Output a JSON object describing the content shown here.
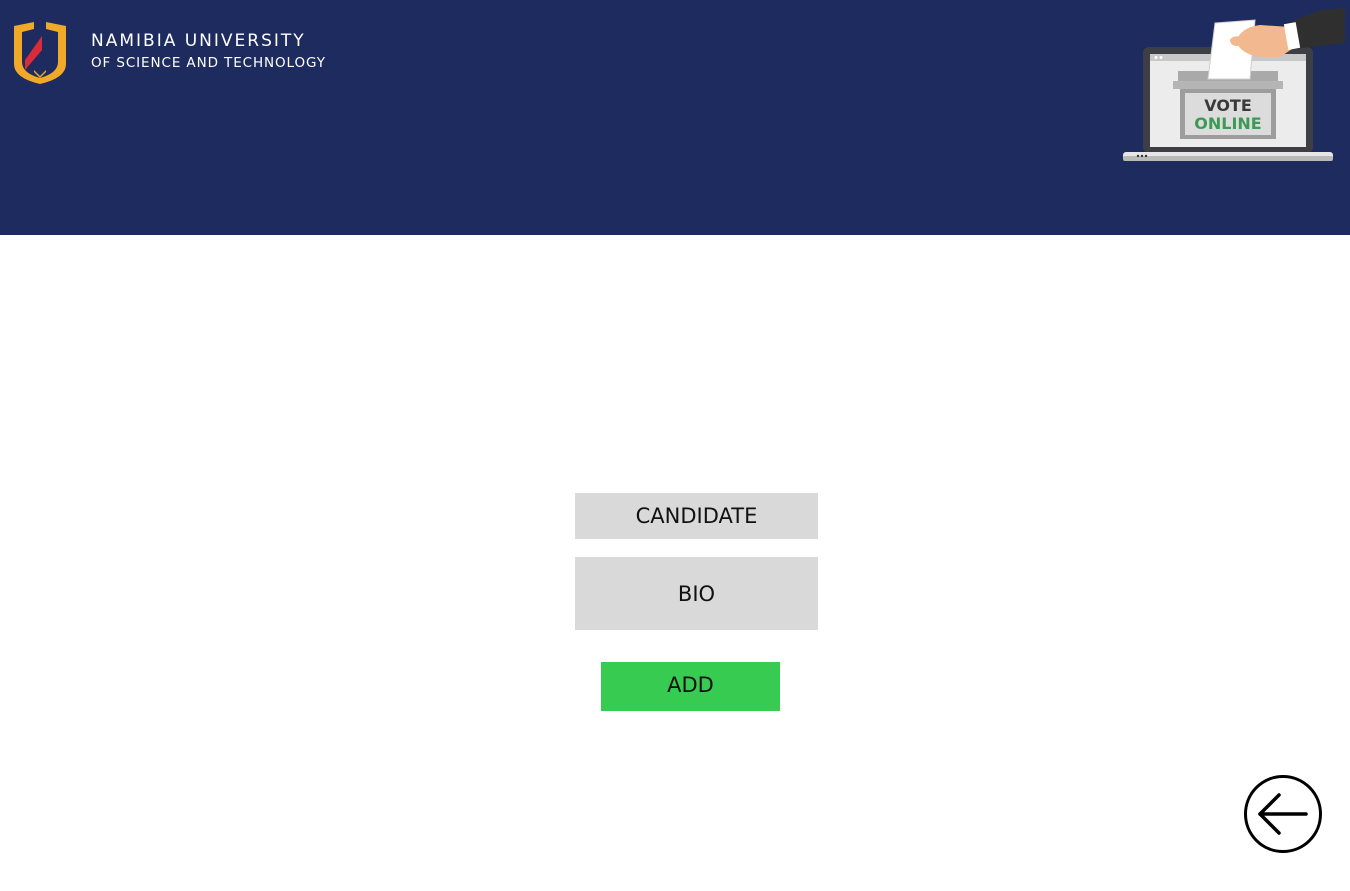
{
  "header": {
    "background_color": "#1e2b5e",
    "logo": {
      "line1": "NAMIBIA UNIVERSITY",
      "line2": "OF SCIENCE AND TECHNOLOGY",
      "icon": "nust-shield-icon"
    },
    "illustration": {
      "icon": "vote-online-laptop-icon",
      "word1": "VOTE",
      "word2": "ONLINE"
    }
  },
  "form": {
    "candidate": {
      "label": "CANDIDATE"
    },
    "bio": {
      "label": "BIO"
    },
    "add_button": {
      "label": "ADD",
      "color": "#37cc51"
    }
  },
  "navigation": {
    "back_icon": "arrow-left-circle-icon"
  }
}
